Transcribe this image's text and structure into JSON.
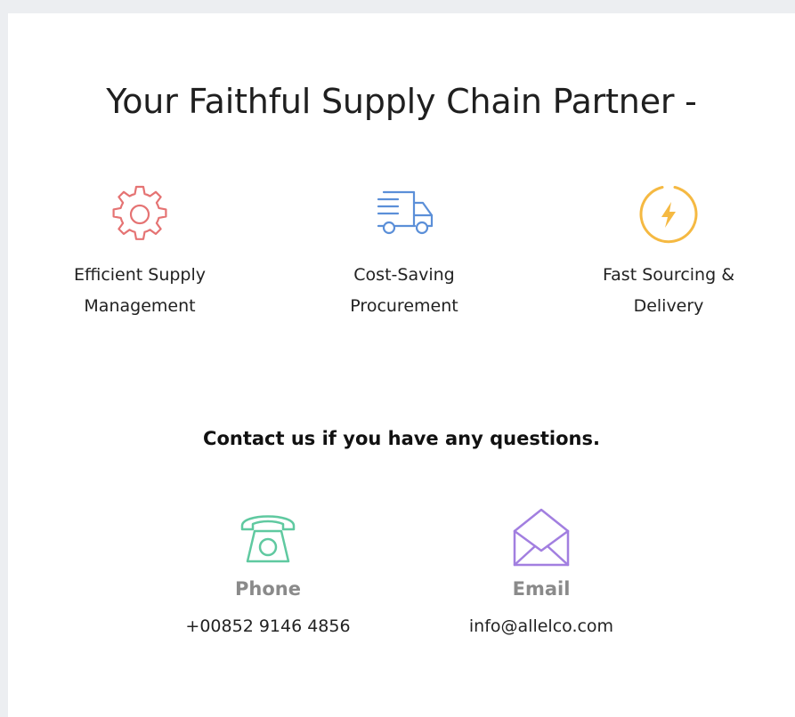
{
  "title": "Your Faithful Supply Chain Partner -",
  "features": [
    {
      "icon": "gear-icon",
      "color": "#e57373",
      "line1": "Efficient Supply",
      "line2": "Management"
    },
    {
      "icon": "delivery-truck-icon",
      "color": "#5b8fd8",
      "line1": "Cost-Saving",
      "line2": "Procurement"
    },
    {
      "icon": "lightning-icon",
      "color": "#f5b942",
      "line1": "Fast Sourcing &",
      "line2": "Delivery"
    }
  ],
  "contact": {
    "heading": "Contact us if you have any questions.",
    "phone": {
      "icon": "telephone-icon",
      "color": "#5fc9a0",
      "label": "Phone",
      "value": "+00852 9146 4856"
    },
    "email": {
      "icon": "envelope-icon",
      "color": "#a27fe0",
      "label": "Email",
      "value": "info@allelco.com"
    }
  },
  "colors": {
    "page_background": "#eceef1",
    "card_background": "#ffffff",
    "muted_heading": "#8a8a8a"
  }
}
